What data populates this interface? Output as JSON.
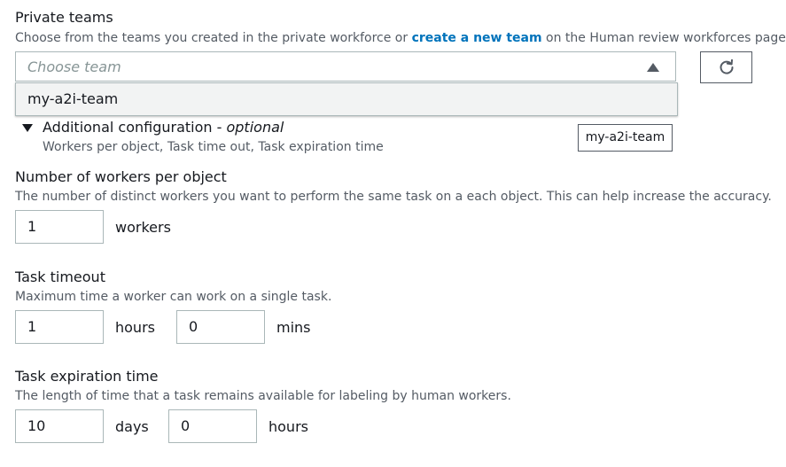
{
  "private_teams": {
    "label": "Private teams",
    "description_before": "Choose from the teams you created in the private workforce or ",
    "description_link": "create a new team",
    "description_after": " on the Human review workforces page.",
    "select_placeholder": "Choose team",
    "options": [
      "my-a2i-team"
    ],
    "refresh_icon": "refresh-icon"
  },
  "additional_config": {
    "title": "Additional configuration - ",
    "title_optional": "optional",
    "subtitle": "Workers per object, Task time out, Task expiration time",
    "tooltip": "my-a2i-team"
  },
  "workers_per_object": {
    "label": "Number of workers per object",
    "description": "The number of distinct workers you want to perform the same task on a each object. This can help increase the accuracy.",
    "value": "1",
    "unit": "workers"
  },
  "task_timeout": {
    "label": "Task timeout",
    "description": "Maximum time a worker can work on a single task.",
    "hours_value": "1",
    "hours_unit": "hours",
    "mins_value": "0",
    "mins_unit": "mins"
  },
  "task_expiration": {
    "label": "Task expiration time",
    "description": "The length of time that a task remains available for labeling by human workers.",
    "days_value": "10",
    "days_unit": "days",
    "hours_value": "0",
    "hours_unit": "hours"
  },
  "colors": {
    "link": "#0073bb",
    "text": "#16191f",
    "muted": "#545b64",
    "border": "#aab7b8",
    "dropdown_bg": "#f2f3f3"
  }
}
